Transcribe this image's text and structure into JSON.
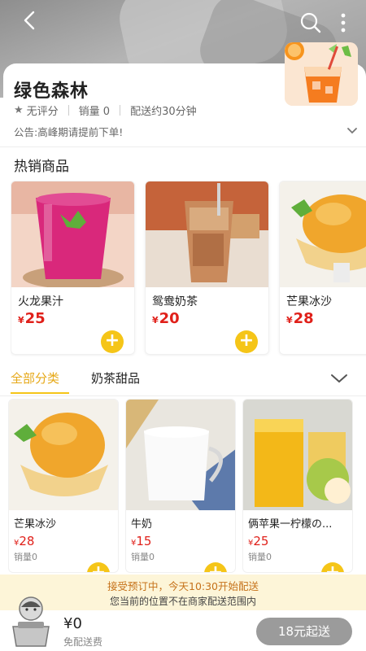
{
  "header": {
    "back_icon": "back-icon",
    "search_icon": "search-icon",
    "more_icon": "more-icon"
  },
  "store": {
    "name": "绿色森林",
    "rating": "无评分",
    "sales": "销量 0",
    "delivery_time": "配送约30分钟",
    "notice": "公告:高峰期请提前下单!"
  },
  "hot": {
    "title": "热销商品",
    "items": [
      {
        "name": "火龙果汁",
        "currency": "¥",
        "price": "25"
      },
      {
        "name": "鸳鸯奶茶",
        "currency": "¥",
        "price": "20"
      },
      {
        "name": "芒果冰沙",
        "currency": "¥",
        "price": "28"
      }
    ]
  },
  "tabs": {
    "items": [
      "全部分类",
      "奶茶甜品"
    ]
  },
  "products": [
    {
      "name": "芒果冰沙",
      "currency": "¥",
      "price": "28",
      "sold": "销量0"
    },
    {
      "name": "牛奶",
      "currency": "¥",
      "price": "15",
      "sold": "销量0"
    },
    {
      "name": "俩苹果一柠檬の...",
      "currency": "¥",
      "price": "25",
      "sold": "销量0"
    }
  ],
  "notice_bar": {
    "line1": "接受预订中，今天10:30开始配送",
    "line2": "您当前的位置不在商家配送范围内"
  },
  "cart": {
    "total": "¥0",
    "delivery": "免配送费",
    "checkout": "18元起送"
  },
  "colors": {
    "accent": "#f5c518",
    "price": "#e0201a",
    "notice_text": "#c6721a"
  }
}
